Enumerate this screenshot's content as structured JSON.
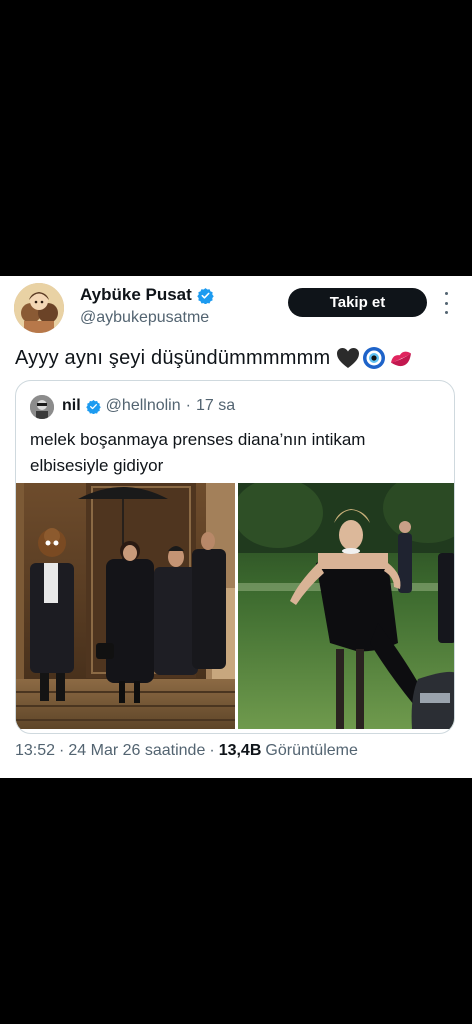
{
  "tweet": {
    "author_name": "Aybüke Pusat",
    "author_handle": "@aybukepusatme",
    "follow_label": "Takip et",
    "text": "Ayyy aynı şeyi düşündümmmmmm",
    "emojis": [
      "black-heart",
      "nazar-amulet",
      "kiss-mark"
    ],
    "time": "13:52",
    "dot1": "·",
    "date": "24 Mar 26 saatinde",
    "dot2": "·",
    "views_count": "13,4B",
    "views_label": "Görüntüleme"
  },
  "quote": {
    "author_name": "nil",
    "author_handle": "@hellnolin",
    "separator": "·",
    "age": "17 sa",
    "text": "melek boşanmaya prenses diana’nın intikam elbisesiyle gidiyor"
  },
  "colors": {
    "verified_blue": "#1d9bf0",
    "text_primary": "#0f1419",
    "text_secondary": "#536471",
    "follow_button_bg": "#0f1419"
  }
}
